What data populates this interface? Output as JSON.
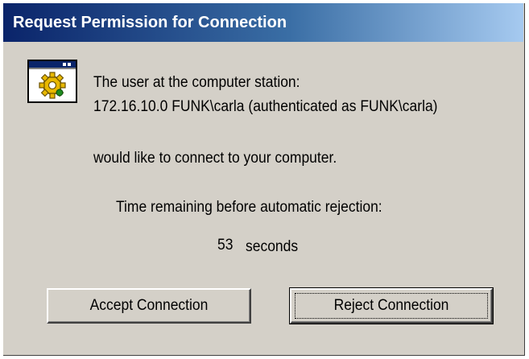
{
  "window": {
    "title": "Request Permission for Connection"
  },
  "message": {
    "line1": "The user at the computer station:",
    "line2": "172.16.10.0 FUNK\\carla (authenticated as FUNK\\carla)",
    "line3": "would like to connect to your computer."
  },
  "countdown": {
    "label": "Time remaining before automatic rejection:",
    "seconds": "53",
    "unit": "seconds"
  },
  "buttons": {
    "accept_label": "Accept Connection",
    "reject_label": "Reject Connection"
  },
  "icons": {
    "app": "window-gear-icon"
  },
  "colors": {
    "title_bar_start": "#0a246a",
    "title_bar_end": "#a6caf0",
    "dialog_bg": "#d4d0c8"
  }
}
